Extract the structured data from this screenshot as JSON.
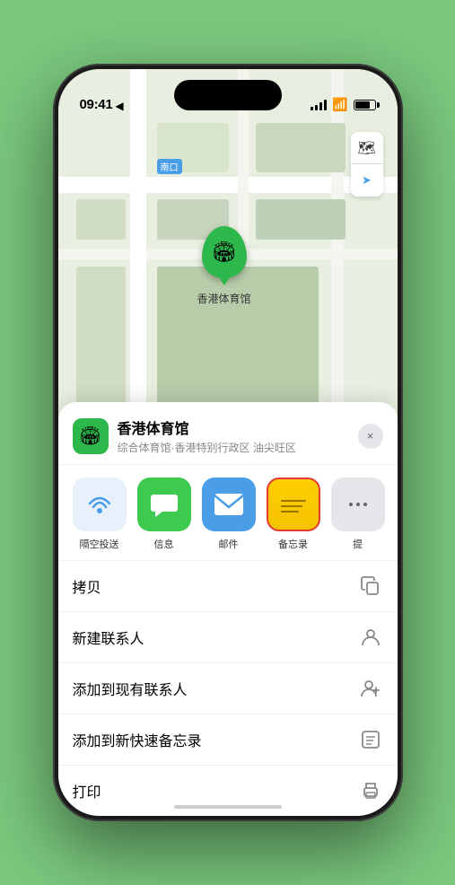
{
  "status_bar": {
    "time": "09:41",
    "location_arrow": "▶"
  },
  "map": {
    "label_tag": "南口",
    "venue_name": "香港体育馆",
    "venue_label": "香港体育馆"
  },
  "map_controls": {
    "layers_icon": "🗺",
    "location_icon": "⬆"
  },
  "sheet": {
    "venue_name": "香港体育馆",
    "venue_subtitle": "综合体育馆·香港特别行政区 油尖旺区",
    "close_label": "×"
  },
  "share_items": [
    {
      "id": "airdrop",
      "label": "隔空投送"
    },
    {
      "id": "messages",
      "label": "信息"
    },
    {
      "id": "mail",
      "label": "邮件"
    },
    {
      "id": "notes",
      "label": "备忘录"
    },
    {
      "id": "more",
      "label": "提"
    }
  ],
  "actions": [
    {
      "id": "copy",
      "label": "拷贝",
      "icon": "copy"
    },
    {
      "id": "new-contact",
      "label": "新建联系人",
      "icon": "person"
    },
    {
      "id": "add-contact",
      "label": "添加到现有联系人",
      "icon": "person-add"
    },
    {
      "id": "quick-note",
      "label": "添加到新快速备忘录",
      "icon": "note"
    },
    {
      "id": "print",
      "label": "打印",
      "icon": "print"
    }
  ]
}
